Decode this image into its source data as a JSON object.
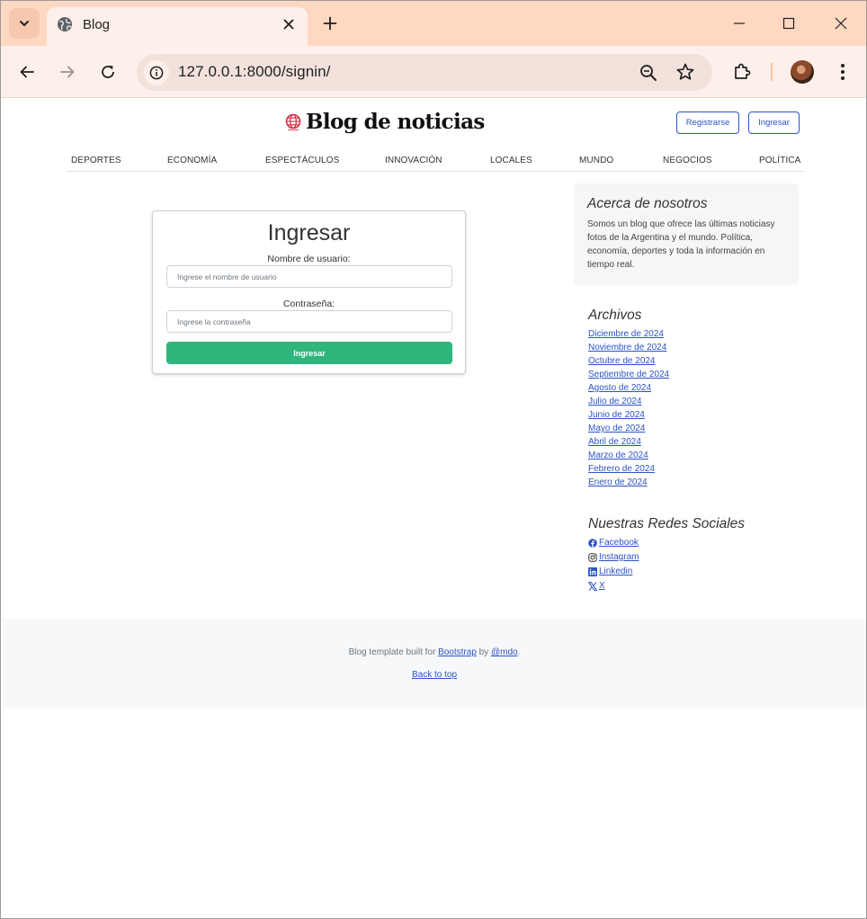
{
  "browser": {
    "tab_title": "Blog",
    "url": "127.0.0.1:8000/signin/"
  },
  "header": {
    "brand_title": "Blog de noticias",
    "register_label": "Registrarse",
    "login_label": "Ingresar"
  },
  "nav": {
    "items": [
      "DEPORTES",
      "ECONOMÍA",
      "ESPECTÁCULOS",
      "INNOVACIÓN",
      "LOCALES",
      "MUNDO",
      "NEGOCIOS",
      "POLÍTICA"
    ]
  },
  "login": {
    "title": "Ingresar",
    "username_label": "Nombre de usuario:",
    "username_placeholder": "Ingrese el nombre de usuario",
    "password_label": "Contraseña:",
    "password_placeholder": "Ingrese la contraseña",
    "submit_label": "Ingresar"
  },
  "sidebar": {
    "about_title": "Acerca de nosotros",
    "about_text": "Somos un blog que ofrece las últimas noticiasy fotos de la Argentina y el mundo. Política, economía, deportes y toda la información en tiempo real.",
    "archives_title": "Archivos",
    "archives": [
      "Diciembre de 2024",
      "Noviembre de 2024",
      "Octubre de 2024",
      "Septiembre de 2024",
      "Agosto de 2024",
      "Julio de 2024",
      "Junio de 2024",
      "Mayo de 2024",
      "Abril de 2024",
      "Marzo de 2024",
      "Febrero de 2024",
      "Enero de 2024"
    ],
    "social_title": "Nuestras Redes Sociales",
    "social": [
      {
        "label": " Facebook",
        "icon": "facebook-icon"
      },
      {
        "label": " Instagram",
        "icon": "instagram-icon"
      },
      {
        "label": " Linkedin",
        "icon": "linkedin-icon"
      },
      {
        "label": " X",
        "icon": "x-icon"
      }
    ]
  },
  "footer": {
    "prefix": "Blog template built for ",
    "bootstrap": "Bootstrap",
    "by": " by ",
    "mdo": "@mdo",
    "suffix": ".",
    "back_to_top": "Back to top"
  },
  "colors": {
    "accent": "#2c53c7",
    "submit": "#2eb67d",
    "tabstrip": "#ffd8c2"
  }
}
